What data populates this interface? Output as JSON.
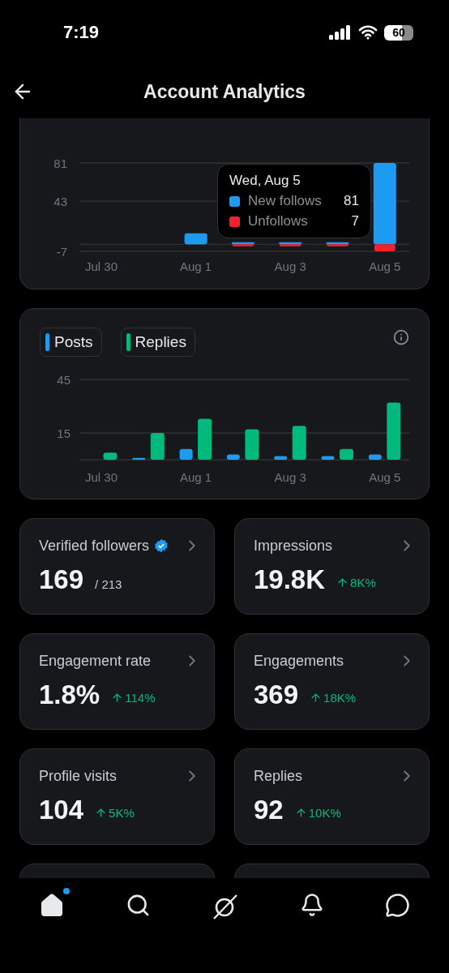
{
  "status_bar": {
    "time": "7:19",
    "battery": "60"
  },
  "header": {
    "title": "Account Analytics"
  },
  "follows_chart": {
    "chart_data": {
      "type": "bar",
      "stacked": true,
      "legend": "lower right",
      "categories": [
        "Jul 30",
        null,
        "Aug 1",
        null,
        "Aug 3",
        null,
        "Aug 5"
      ],
      "ylim": [
        -7,
        81
      ],
      "yticks": [
        -7,
        43,
        81
      ],
      "series": [
        {
          "name": "New follows",
          "color": "#1d9bf0",
          "values": [
            0,
            0,
            11,
            2,
            2,
            2,
            81
          ]
        },
        {
          "name": "Unfollows",
          "color": "#f4212e",
          "values": [
            0,
            0,
            0,
            -2,
            -2,
            -2,
            -7
          ]
        }
      ]
    },
    "tooltip": {
      "date": "Wed, Aug 5",
      "values": [
        "81",
        "7"
      ]
    }
  },
  "posts_chart": {
    "chart_data": {
      "type": "bar",
      "stacked": false,
      "legend": "top",
      "categories": [
        "Jul 30",
        null,
        "Aug 1",
        null,
        "Aug 3",
        null,
        "Aug 5"
      ],
      "ylim": [
        0,
        45
      ],
      "yticks": [
        15,
        45
      ],
      "series": [
        {
          "name": "Posts",
          "color": "#1d9bf0",
          "values": [
            0,
            1,
            6,
            3,
            2,
            2,
            3
          ]
        },
        {
          "name": "Replies",
          "color": "#00ba7c",
          "values": [
            4,
            15,
            23,
            17,
            19,
            6,
            32
          ]
        }
      ]
    }
  },
  "metrics": [
    {
      "title": "Verified followers",
      "verified": true,
      "value": "169",
      "secondary": {
        "kind": "total",
        "text": "/ 213"
      }
    },
    {
      "title": "Impressions",
      "verified": false,
      "value": "19.8K",
      "secondary": {
        "kind": "change",
        "text": "8K%"
      }
    },
    {
      "title": "Engagement rate",
      "verified": false,
      "value": "1.8%",
      "secondary": {
        "kind": "change",
        "text": "114%"
      }
    },
    {
      "title": "Engagements",
      "verified": false,
      "value": "369",
      "secondary": {
        "kind": "change",
        "text": "18K%"
      }
    },
    {
      "title": "Profile visits",
      "verified": false,
      "value": "104",
      "secondary": {
        "kind": "change",
        "text": "5K%"
      }
    },
    {
      "title": "Replies",
      "verified": false,
      "value": "92",
      "secondary": {
        "kind": "change",
        "text": "10K%"
      }
    }
  ],
  "nav": [
    {
      "kind": "home",
      "selected": true,
      "badge": true
    },
    {
      "kind": "search",
      "selected": false
    },
    {
      "kind": "grok",
      "selected": false
    },
    {
      "kind": "notifications",
      "selected": false
    },
    {
      "kind": "messages",
      "selected": false
    }
  ]
}
